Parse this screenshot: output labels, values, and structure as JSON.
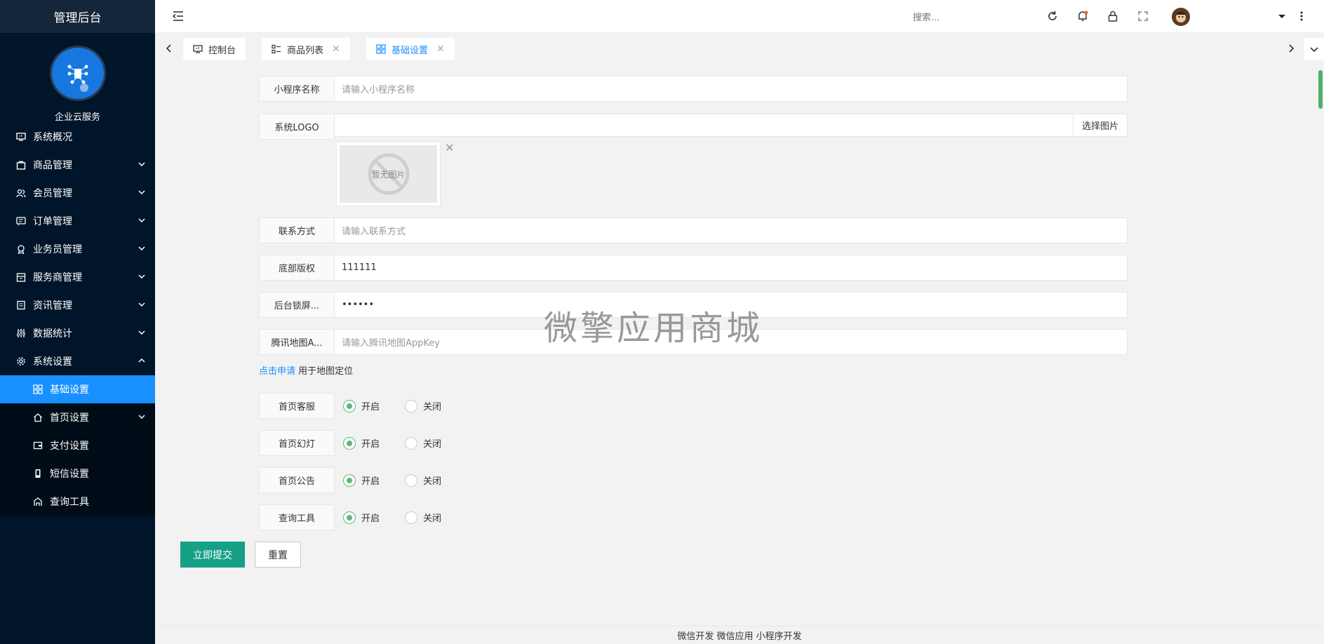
{
  "sidebar": {
    "brand": "管理后台",
    "company": "企业云服务",
    "items": [
      {
        "label": "系统概况",
        "icon": "dashboard-icon"
      },
      {
        "label": "商品管理",
        "icon": "bag-icon"
      },
      {
        "label": "会员管理",
        "icon": "users-icon"
      },
      {
        "label": "订单管理",
        "icon": "order-icon"
      },
      {
        "label": "业务员管理",
        "icon": "badge-icon"
      },
      {
        "label": "服务商管理",
        "icon": "store-icon"
      },
      {
        "label": "资讯管理",
        "icon": "news-icon"
      },
      {
        "label": "数据统计",
        "icon": "sliders-icon"
      },
      {
        "label": "系统设置",
        "icon": "gear-icon"
      }
    ],
    "sub_items": [
      {
        "label": "基础设置",
        "icon": "grid-icon"
      },
      {
        "label": "首页设置",
        "icon": "home-icon"
      },
      {
        "label": "支付设置",
        "icon": "wallet-icon"
      },
      {
        "label": "短信设置",
        "icon": "phone-icon"
      },
      {
        "label": "查询工具",
        "icon": "tool-icon"
      }
    ]
  },
  "header": {
    "search_placeholder": "搜索..."
  },
  "tabs": [
    {
      "label": "控制台"
    },
    {
      "label": "商品列表"
    },
    {
      "label": "基础设置"
    }
  ],
  "form": {
    "app_name": {
      "label": "小程序名称",
      "placeholder": "请输入小程序名称"
    },
    "logo": {
      "label": "系统LOGO",
      "button": "选择图片",
      "no_image": "暂无图片"
    },
    "contact": {
      "label": "联系方式",
      "placeholder": "请输入联系方式"
    },
    "copyright": {
      "label": "底部版权",
      "value": "111111"
    },
    "lock": {
      "label": "后台锁屏...",
      "value": "••••••"
    },
    "map": {
      "label": "腾讯地图A...",
      "placeholder": "请输入腾讯地图AppKey"
    },
    "hint_link": "点击申请",
    "hint_text": " 用于地图定位",
    "radios": [
      {
        "label": "首页客服",
        "on": "开启",
        "off": "关闭"
      },
      {
        "label": "首页幻灯",
        "on": "开启",
        "off": "关闭"
      },
      {
        "label": "首页公告",
        "on": "开启",
        "off": "关闭"
      },
      {
        "label": "查询工具",
        "on": "开启",
        "off": "关闭"
      }
    ],
    "submit": "立即提交",
    "reset": "重置"
  },
  "watermark": "微擎应用商城",
  "footer": "微信开发 微信应用 小程序开发",
  "colors": {
    "sidebar_bg": "#001529",
    "active": "#1890ff",
    "primary_btn": "#16a085",
    "radio_on": "#5fb878"
  }
}
